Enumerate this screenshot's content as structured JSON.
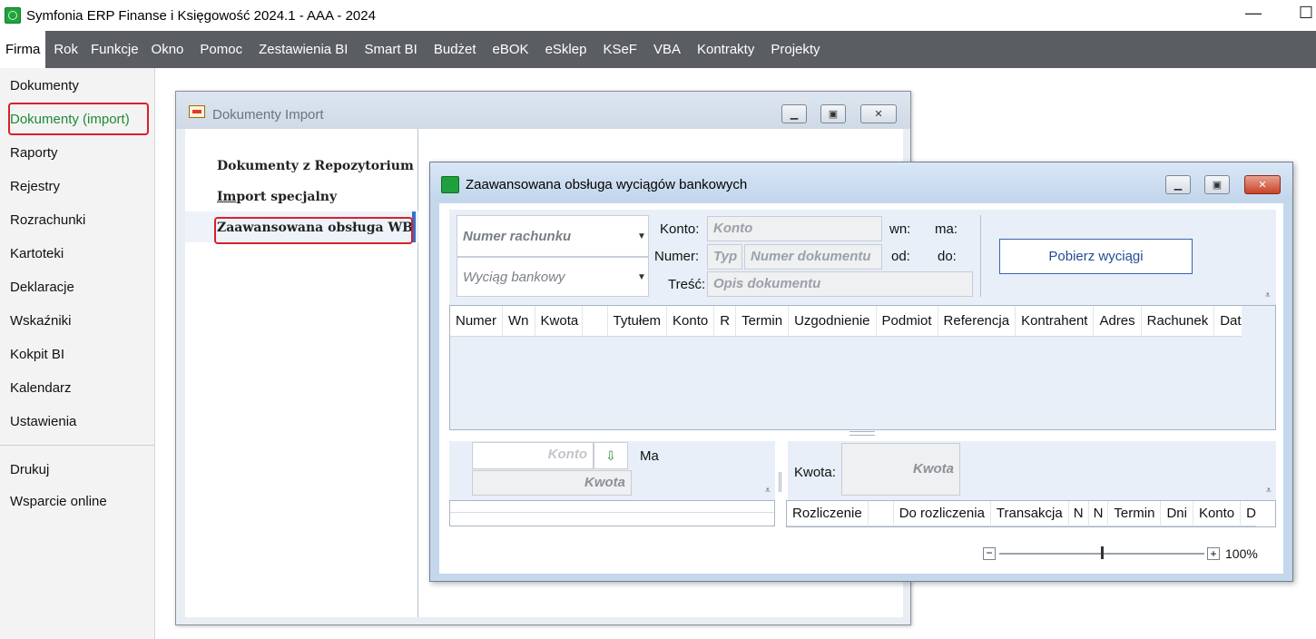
{
  "app": {
    "title": "Symfonia ERP Finanse i Księgowość 2024.1 - AAA - 2024",
    "minimize": "—",
    "maximize": "☐"
  },
  "menu": [
    "Firma",
    "Rok",
    "Funkcje",
    "Okno",
    "Pomoc",
    "Zestawienia BI",
    "Smart BI",
    "Budżet",
    "eBOK",
    "eSklep",
    "KSeF",
    "VBA",
    "Kontrakty",
    "Projekty"
  ],
  "sidebar": {
    "items": [
      "Dokumenty",
      "Dokumenty (import)",
      "Raporty",
      "Rejestry",
      "Rozrachunki",
      "Kartoteki",
      "Deklaracje",
      "Wskaźniki",
      "Kokpit BI",
      "Kalendarz",
      "Ustawienia"
    ],
    "bottom": [
      "Drukuj",
      "Wsparcie online"
    ]
  },
  "import_window": {
    "title": "Dokumenty Import",
    "items": [
      "Dokumenty z Repozytorium",
      "Import specjalny",
      "Zaawansowana obsługa WB"
    ],
    "item2_underline": "Im",
    "item2_rest": "port specjalny"
  },
  "wb_window": {
    "title": "Zaawansowana obsługa wyciągów bankowych",
    "numer_rachunku": "Numer rachunku",
    "wyciag_bankowy": "Wyciąg bankowy",
    "konto_label": "Konto:",
    "konto_value": "Konto",
    "numer_label": "Numer:",
    "typ_value": "Typ",
    "numer_dok_value": "Numer dokumentu",
    "tresc_label": "Treść:",
    "opis_value": "Opis dokumentu",
    "wn": "wn:",
    "ma": "ma:",
    "od": "od:",
    "do": "do:",
    "pobierz": "Pobierz wyciągi",
    "grid_columns": [
      "Numer",
      "Wn",
      "Kwota",
      "",
      "Tytułem",
      "Konto",
      "R",
      "Termin",
      "Uzgodnienie",
      "Podmiot",
      "Referencja",
      "Kontrahent",
      "Adres",
      "Rachunek",
      "Dat"
    ],
    "lower_konto": "Konto",
    "lower_kwota": "Kwota",
    "lower_ma": "Ma",
    "kwota_label": "Kwota:",
    "kwota_value": "Kwota",
    "right_columns": [
      "Rozliczenie",
      "",
      "Do rozliczenia",
      "Transakcja",
      "N",
      "N",
      "Termin",
      "Dni",
      "Konto",
      "D"
    ],
    "zoom_minus": "−",
    "zoom_plus": "+",
    "zoom_value": "100%"
  }
}
